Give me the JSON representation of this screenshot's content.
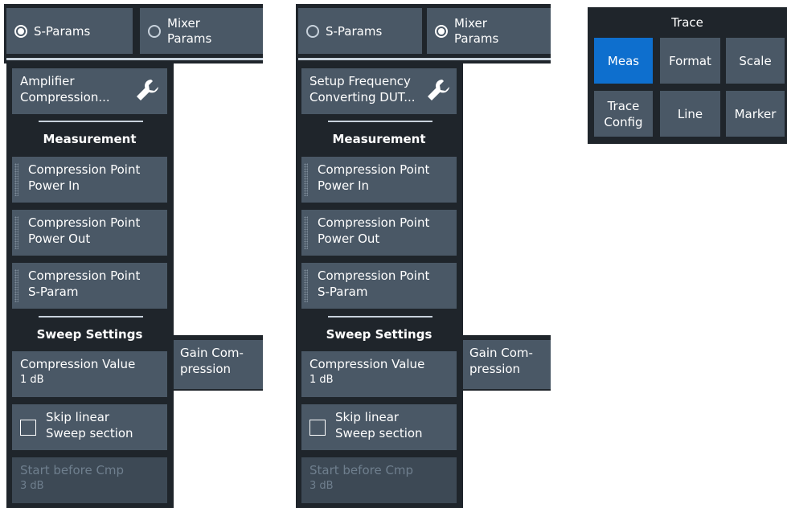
{
  "left_panel": {
    "mode_sparams": "S-Params",
    "mode_mixer_line1": "Mixer",
    "mode_mixer_line2": "Params",
    "setup_line1": "Amplifier",
    "setup_line2": "Compression...",
    "measurement_title": "Measurement",
    "btn1_line1": "Compression Point",
    "btn1_line2": "Power In",
    "btn2_line1": "Compression Point",
    "btn2_line2": "Power Out",
    "btn3_line1": "Compression Point",
    "btn3_line2": "S-Param",
    "sweep_title": "Sweep Settings",
    "compression_value_label": "Compression Value",
    "compression_value": "1 dB",
    "skip_line1": "Skip linear",
    "skip_line2": "Sweep section",
    "start_label": "Start before Cmp",
    "start_value": "3 dB",
    "gain_tab_line1": "Gain Com-",
    "gain_tab_line2": "pression"
  },
  "right_panel": {
    "mode_sparams": "S-Params",
    "mode_mixer_line1": "Mixer",
    "mode_mixer_line2": "Params",
    "setup_line1": "Setup Frequency",
    "setup_line2": "Converting DUT...",
    "measurement_title": "Measurement",
    "btn1_line1": "Compression Point",
    "btn1_line2": "Power In",
    "btn2_line1": "Compression Point",
    "btn2_line2": "Power Out",
    "btn3_line1": "Compression Point",
    "btn3_line2": "S-Param",
    "sweep_title": "Sweep Settings",
    "compression_value_label": "Compression Value",
    "compression_value": "1 dB",
    "skip_line1": "Skip linear",
    "skip_line2": "Sweep section",
    "start_label": "Start before Cmp",
    "start_value": "3 dB",
    "gain_tab_line1": "Gain Com-",
    "gain_tab_line2": "pression"
  },
  "trace_panel": {
    "title": "Trace",
    "meas": "Meas",
    "format": "Format",
    "scale": "Scale",
    "trace_config_line1": "Trace",
    "trace_config_line2": "Config",
    "line": "Line",
    "marker": "Marker"
  },
  "colors": {
    "button_bg": "#4a5866",
    "panel_bg": "#1f252b",
    "active_blue": "#0e6fce"
  }
}
